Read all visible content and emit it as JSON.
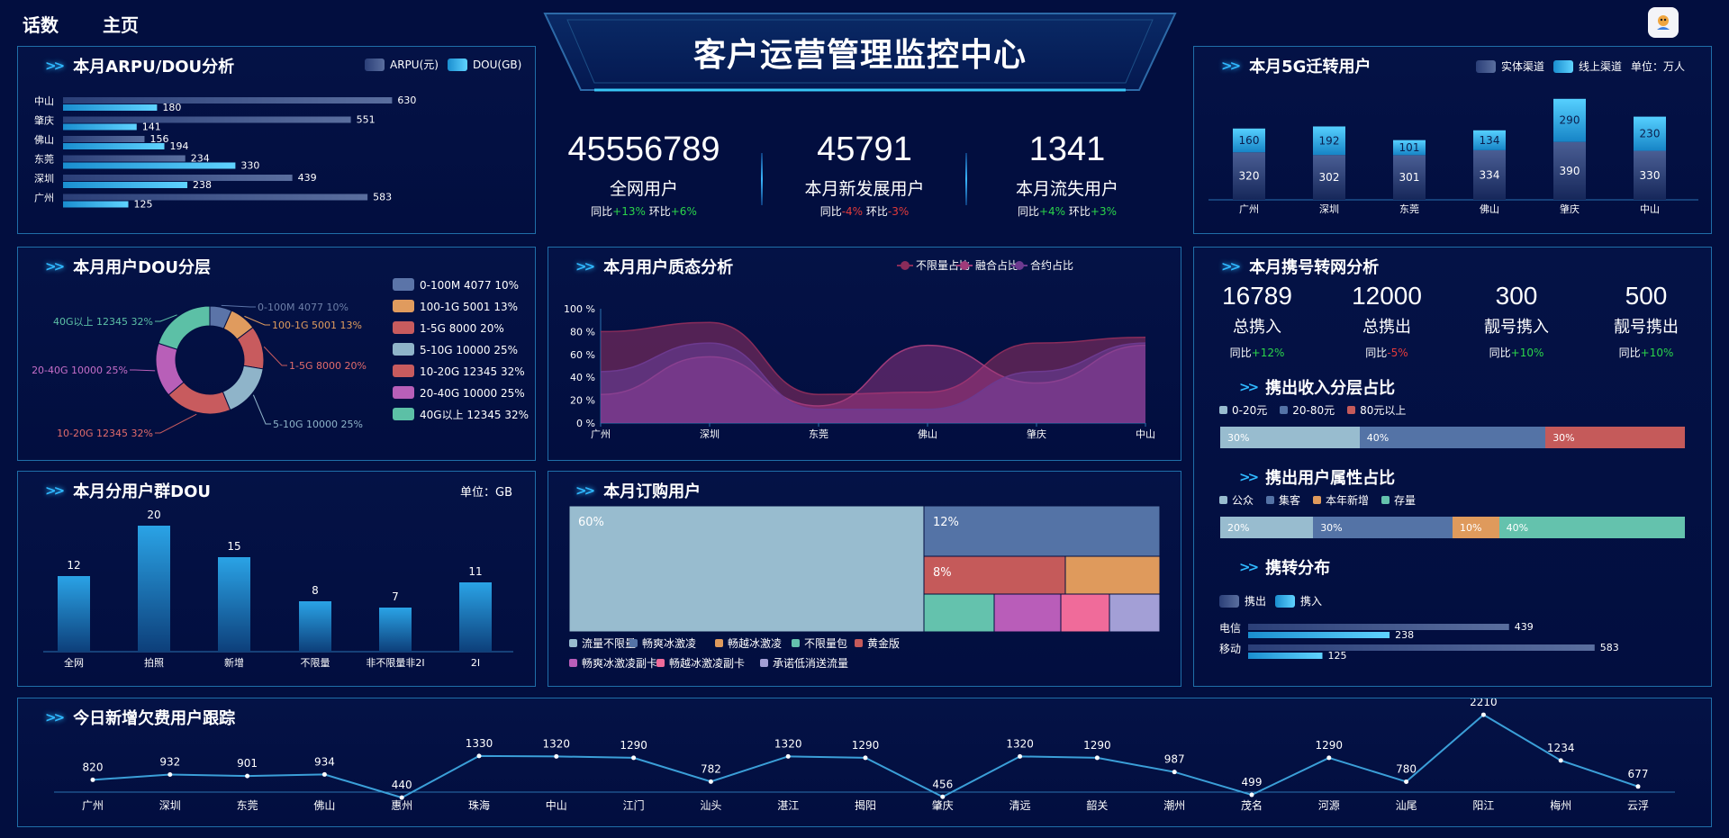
{
  "nav": {
    "item1": "话数",
    "item2": "主页"
  },
  "header": {
    "title": "客户运营管理监控中心"
  },
  "kpis": [
    {
      "value": "45556789",
      "label": "全网用户",
      "yoy_label": "同比",
      "yoy": "+13%",
      "mom_label": "环比",
      "mom": "+6%"
    },
    {
      "value": "45791",
      "label": "本月新发展用户",
      "yoy_label": "同比",
      "yoy": "-4%",
      "mom_label": "环比",
      "mom": "-3%"
    },
    {
      "value": "1341",
      "label": "本月流失用户",
      "yoy_label": "同比",
      "yoy": "+4%",
      "mom_label": "环比",
      "mom": "+3%"
    }
  ],
  "p1": {
    "title": "本月ARPU/DOU分析",
    "legend": [
      "ARPU(元)",
      "DOU(GB)"
    ]
  },
  "p2": {
    "title": "本月用户DOU分层"
  },
  "p3": {
    "title": "本月分用户群DOU",
    "unit": "单位：GB"
  },
  "p4": {
    "title": "本月用户质态分析"
  },
  "p5": {
    "title": "本月订购用户"
  },
  "p6": {
    "title": "本月5G迁转用户",
    "legend": [
      "实体渠道",
      "线上渠道"
    ],
    "unit": "单位：万人"
  },
  "p7": {
    "title": "本月携号转网分析",
    "stats": [
      {
        "value": "16789",
        "label": "总携入",
        "yoy_label": "同比",
        "yoy": "+12%"
      },
      {
        "value": "12000",
        "label": "总携出",
        "yoy_label": "同比",
        "yoy": "-5%"
      },
      {
        "value": "300",
        "label": "靓号携入",
        "yoy_label": "同比",
        "yoy": "+10%"
      },
      {
        "value": "500",
        "label": "靓号携出",
        "yoy_label": "同比",
        "yoy": "+10%"
      }
    ],
    "income_title": "携出收入分层占比",
    "income_legend": [
      "0-20元",
      "20-80元",
      "80元以上"
    ],
    "income_values": [
      "30%",
      "40%",
      "30%"
    ],
    "attr_title": "携出用户属性占比",
    "attr_legend": [
      "公众",
      "集客",
      "本年新增",
      "存量"
    ],
    "attr_values": [
      "20%",
      "30%",
      "10%",
      "40%"
    ],
    "dist_title": "携转分布",
    "dist_legend": [
      "携出",
      "携入"
    ]
  },
  "p8": {
    "title": "今日新增欠费用户跟踪"
  },
  "colors": {
    "bg": "#020e3f",
    "border": "#1f6ea8",
    "accent": "#2fb8ff",
    "up": "#2bd44a",
    "down": "#e23b3b"
  },
  "chart_data": [
    {
      "type": "bar",
      "id": "arpu",
      "categories": [
        "中山",
        "肇庆",
        "佛山",
        "东莞",
        "深圳",
        "广州"
      ],
      "series": [
        {
          "name": "ARPU(元)",
          "values": [
            630,
            551,
            156,
            234,
            439,
            583
          ]
        },
        {
          "name": "DOU(GB)",
          "values": [
            180,
            141,
            194,
            330,
            238,
            125
          ]
        }
      ]
    },
    {
      "type": "pie",
      "id": "doulayer",
      "labels": [
        "0-100M 4077 10%",
        "100-1G 5001 13%",
        "1-5G 8000 20%",
        "5-10G 10000 25%",
        "10-20G 12345 32%",
        "20-40G 10000 25%",
        "40G以上 12345 32%"
      ],
      "values": [
        4077,
        5001,
        8000,
        10000,
        12345,
        10000,
        12345
      ],
      "colors": [
        "#5b74a8",
        "#e09b5e",
        "#c85b5e",
        "#8fb4c9",
        "#c85b5e",
        "#b85fb8",
        "#5cc0a6"
      ]
    },
    {
      "type": "bar",
      "id": "groupdou",
      "categories": [
        "全网",
        "拍照",
        "新增",
        "不限量",
        "非不限量非2I",
        "2I"
      ],
      "values": [
        12,
        20,
        15,
        8,
        7,
        11
      ]
    },
    {
      "type": "area",
      "id": "quality",
      "categories": [
        "广州",
        "深圳",
        "东莞",
        "佛山",
        "肇庆",
        "中山"
      ],
      "ylim": [
        0,
        100
      ],
      "yticks": [
        "0 %",
        "20 %",
        "40 %",
        "60 %",
        "80 %",
        "100 %"
      ],
      "series": [
        {
          "name": "不限量占比",
          "values": [
            80,
            88,
            25,
            27,
            70,
            75
          ]
        },
        {
          "name": "融合占比",
          "values": [
            25,
            58,
            15,
            68,
            35,
            68
          ]
        },
        {
          "name": "合约占比",
          "values": [
            45,
            70,
            12,
            12,
            45,
            70
          ]
        }
      ]
    },
    {
      "type": "treemap",
      "id": "order",
      "labels": [
        "流量不限量",
        "畅爽冰激凌",
        "畅越冰激凌",
        "不限量包",
        "黄金版",
        "畅爽冰激凌副卡",
        "畅越冰激凌副卡",
        "承诺低消送流量"
      ],
      "values": [
        60,
        12,
        6,
        8,
        8,
        3,
        2,
        1
      ],
      "texts": [
        "60%",
        "12%",
        "",
        "",
        "8%",
        "",
        "",
        ""
      ],
      "colors": [
        "#98bccf",
        "#5473a6",
        "#df9a5c",
        "#64c2ad",
        "#c55a5a",
        "#b95db9",
        "#f06b9a",
        "#a39fd6"
      ]
    },
    {
      "type": "bar",
      "id": "g5",
      "categories": [
        "广州",
        "深圳",
        "东莞",
        "佛山",
        "肇庆",
        "中山"
      ],
      "series": [
        {
          "name": "实体渠道",
          "values": [
            320,
            302,
            301,
            334,
            390,
            330
          ]
        },
        {
          "name": "线上渠道",
          "values": [
            160,
            192,
            101,
            134,
            290,
            230
          ]
        }
      ]
    },
    {
      "type": "bar",
      "id": "portdist",
      "categories": [
        "电信",
        "移动"
      ],
      "series": [
        {
          "name": "携出",
          "values": [
            439,
            583
          ]
        },
        {
          "name": "携入",
          "values": [
            238,
            125
          ]
        }
      ]
    },
    {
      "type": "line",
      "id": "arrears",
      "categories": [
        "广州",
        "深圳",
        "东莞",
        "佛山",
        "惠州",
        "珠海",
        "中山",
        "江门",
        "汕头",
        "湛江",
        "揭阳",
        "肇庆",
        "清远",
        "韶关",
        "潮州",
        "茂名",
        "河源",
        "汕尾",
        "阳江",
        "梅州",
        "云浮"
      ],
      "values": [
        820,
        932,
        901,
        934,
        440,
        1330,
        1320,
        1290,
        782,
        1320,
        1290,
        456,
        1320,
        1290,
        987,
        499,
        1290,
        780,
        2210,
        1234,
        677
      ]
    }
  ]
}
